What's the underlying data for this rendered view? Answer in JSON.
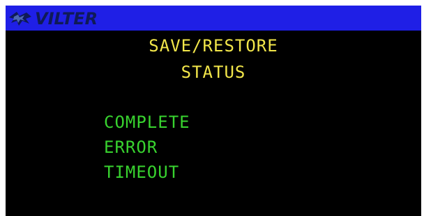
{
  "header": {
    "logo_text": "VILTER",
    "logo_icon": "vilter-logo-icon",
    "bar_color": "#1f1fe6"
  },
  "title": {
    "line1": "SAVE/RESTORE",
    "line2": "STATUS",
    "color": "#f2e64a"
  },
  "status_items": [
    {
      "label": "COMPLETE"
    },
    {
      "label": "ERROR"
    },
    {
      "label": "TIMEOUT"
    }
  ],
  "status_color": "#38d32f",
  "background": "#000000"
}
